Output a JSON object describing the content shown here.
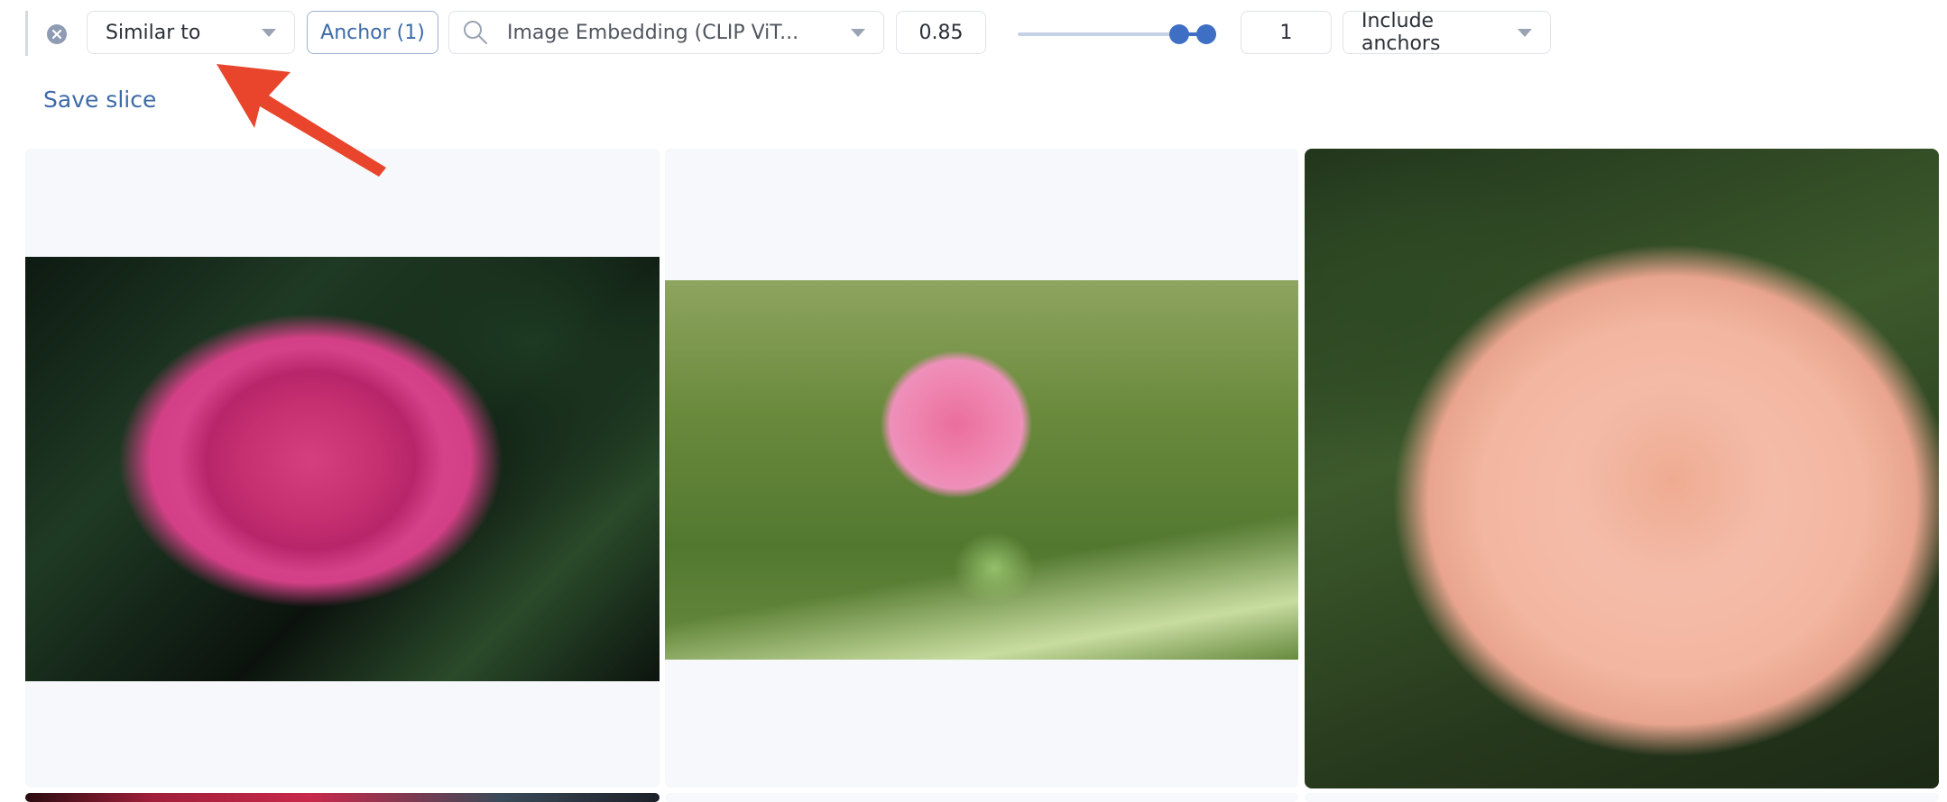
{
  "toolbar": {
    "close_icon": "close-circle-icon",
    "operator_select": {
      "value": "Similar to",
      "icon": "caret-down-icon"
    },
    "anchor_button": {
      "label": "Anchor (1)"
    },
    "embedding_select": {
      "value": "Image Embedding (CLIP ViT...",
      "icon": "search-icon"
    },
    "threshold_input": {
      "value": "0.85"
    },
    "range_slider": {
      "min": 0,
      "max": 1,
      "low": 0.85,
      "high": 1.0,
      "track_color": "#c5d2e6",
      "accent": "#3f6fc4"
    },
    "count_input": {
      "value": "1"
    },
    "include_select": {
      "value": "Include anchors",
      "icon": "caret-down-icon"
    }
  },
  "actions": {
    "save_slice": "Save slice"
  },
  "results": {
    "items": [
      {
        "subject": "pink rose, top view, dark foliage background"
      },
      {
        "subject": "pink rose bud, green background"
      },
      {
        "subject": "peach rose, close-up"
      }
    ],
    "next_row_peek": 3
  },
  "annotation": {
    "type": "arrow",
    "color": "#e8452c",
    "points_to": "operator_select"
  },
  "colors": {
    "link": "#3d6aa8",
    "cell_bg": "#f7f8fc",
    "border": "#dfe2e7"
  }
}
